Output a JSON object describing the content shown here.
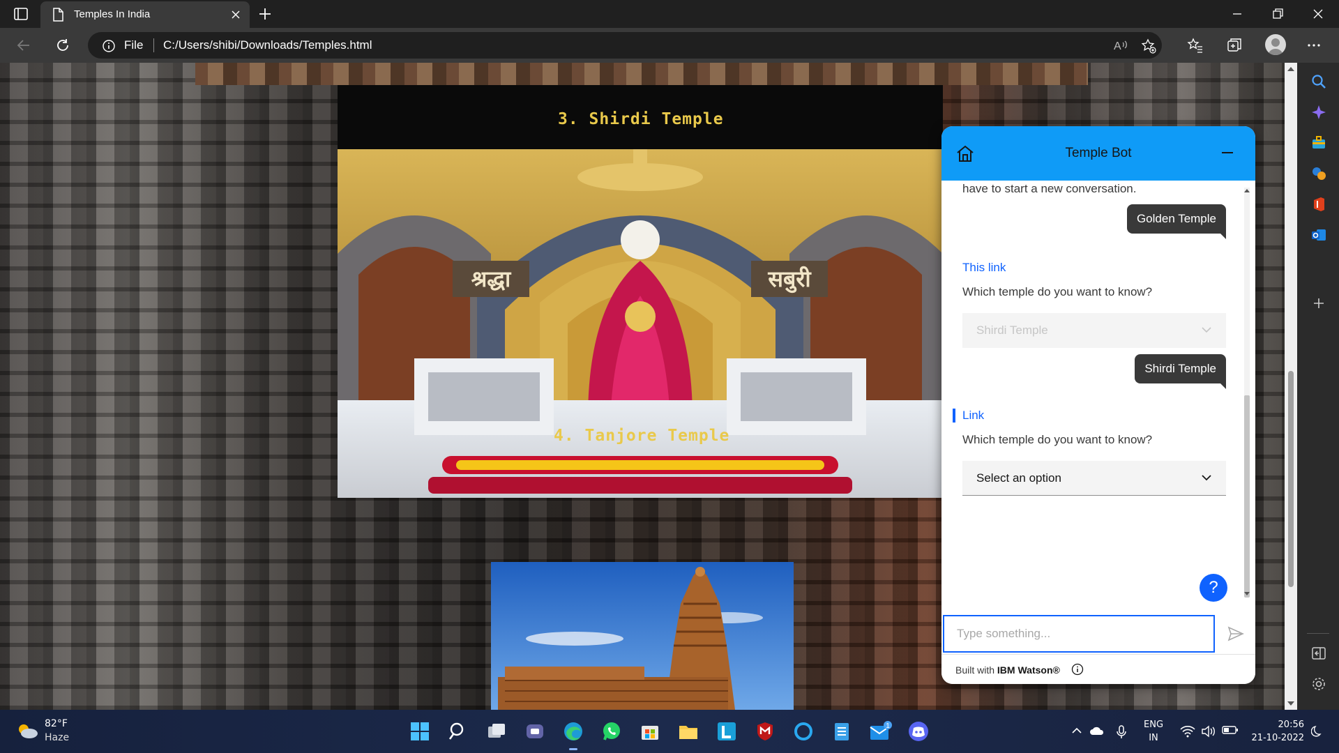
{
  "browser": {
    "tab_title": "Temples In India",
    "address_scheme_label": "File",
    "url": "C:/Users/shibi/Downloads/Temples.html"
  },
  "page": {
    "heading_shirdi": "3. Shirdi Temple",
    "heading_tanjore": "4. Tanjore Temple",
    "shirdi_sign_left": "श्रद्धा",
    "shirdi_sign_right": "सबुरी"
  },
  "chatbot": {
    "title": "Temple Bot",
    "messages": {
      "truncated_text": "have to start a new conversation.",
      "user_golden": "Golden Temple",
      "link_1": "This link",
      "question_1": "Which temple do you want to know?",
      "dropdown_1_value": "Shirdi Temple",
      "user_shirdi": "Shirdi Temple",
      "link_2": "Link",
      "question_2": "Which temple do you want to know?",
      "dropdown_2_placeholder": "Select an option"
    },
    "help_label": "?",
    "input_placeholder": "Type something...",
    "footer_prefix": "Built with ",
    "footer_brand": "IBM Watson®"
  },
  "taskbar": {
    "weather_temp": "82°F",
    "weather_desc": "Haze",
    "lang_line1": "ENG",
    "lang_line2": "IN",
    "time": "20:56",
    "date": "21-10-2022",
    "mail_badge": "1"
  },
  "colors": {
    "chat_header": "#0f9bf7",
    "accent_blue": "#0f62fe",
    "heading_gold": "#e9c94b",
    "bubble_dark": "#393939"
  }
}
